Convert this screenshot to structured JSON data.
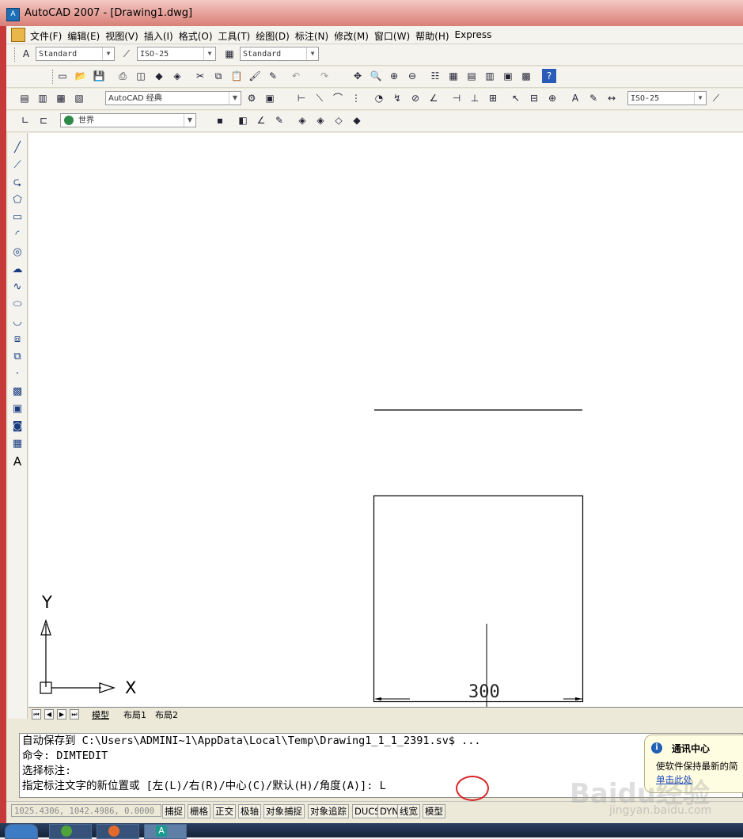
{
  "window": {
    "title": "AutoCAD 2007 - [Drawing1.dwg]",
    "icon": "autocad-app-icon"
  },
  "menu": {
    "items": [
      "文件(F)",
      "编辑(E)",
      "视图(V)",
      "插入(I)",
      "格式(O)",
      "工具(T)",
      "绘图(D)",
      "标注(N)",
      "修改(M)",
      "窗口(W)",
      "帮助(H)",
      "Express"
    ]
  },
  "toolbars": {
    "styles": {
      "text_style": "Standard",
      "dim_style": "ISO-25",
      "table_style": "Standard"
    },
    "workspace": "AutoCAD 经典",
    "dim_style_right": "ISO-25",
    "ucs": "世界"
  },
  "drawing": {
    "dimension_text": "300",
    "ucs_x_label": "X",
    "ucs_y_label": "Y"
  },
  "layout_tabs": [
    "模型",
    "布局1",
    "布局2"
  ],
  "command_lines": [
    "自动保存到 C:\\Users\\ADMINI~1\\AppData\\Local\\Temp\\Drawing1_1_1_2391.sv$ ...",
    "命令: DIMTEDIT",
    "选择标注:",
    "指定标注文字的新位置或 [左(L)/右(R)/中心(C)/默认(H)/角度(A)]: L"
  ],
  "statusbar": {
    "coords": "1025.4306, 1042.4986, 0.0000",
    "buttons": [
      "捕捉",
      "栅格",
      "正交",
      "极轴",
      "对象捕捉",
      "对象追踪",
      "DUCS",
      "DYN",
      "线宽",
      "模型"
    ]
  },
  "notification": {
    "title": "通讯中心",
    "body": "使软件保持最新的简",
    "link": "单击此处"
  },
  "watermark": {
    "brand": "Baidu经验",
    "url": "jingyan.baidu.com"
  },
  "colors": {
    "annotation_circle": "#d9262a",
    "titlebar": "#e59f98",
    "link": "#1c48c0"
  }
}
